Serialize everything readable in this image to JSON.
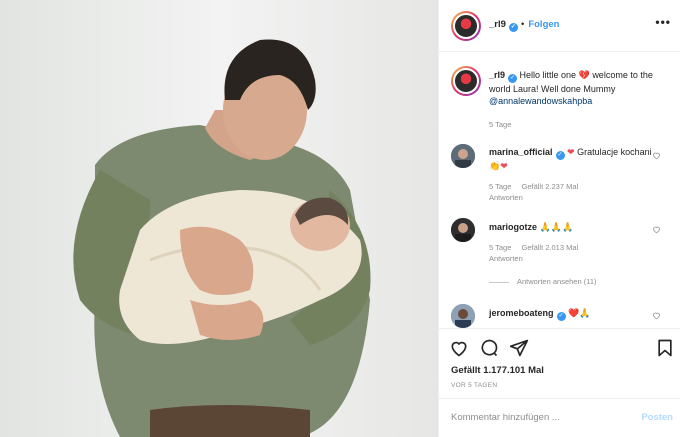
{
  "post": {
    "photo_alt": "Man in green sweater holding newborn wrapped in cream blanket"
  },
  "header": {
    "username": "_rl9",
    "follow_label": "Folgen",
    "more_label": "•••"
  },
  "caption": {
    "username": "_rl9",
    "text_part1": "Hello little one",
    "text_part2": "welcome to the world Laura! Well done Mummy",
    "mention": "@annalewandowskahpba",
    "time": "5 Tage"
  },
  "comments": [
    {
      "username": "marina_official",
      "text": "Gratulacje kochani",
      "time": "5 Tage",
      "likes": "Gefällt 2.237 Mal",
      "reply": "Antworten"
    },
    {
      "username": "mariogotze",
      "text": "🙏🙏🙏",
      "time": "5 Tage",
      "likes": "Gefällt 2.013 Mal",
      "reply": "Antworten",
      "view_replies": "Antworten ansehen (11)"
    },
    {
      "username": "jeromeboateng",
      "text": "❤️🙏"
    }
  ],
  "footer": {
    "likes": "Gefällt 1.177.101 Mal",
    "date": "VOR 5 TAGEN",
    "comment_placeholder": "Kommentar hinzufügen ...",
    "post_label": "Posten"
  },
  "colors": {
    "accent": "#3897f0",
    "heart": "#ed4956",
    "sweater": "#7d8a6f",
    "blanket": "#efe7d6"
  }
}
